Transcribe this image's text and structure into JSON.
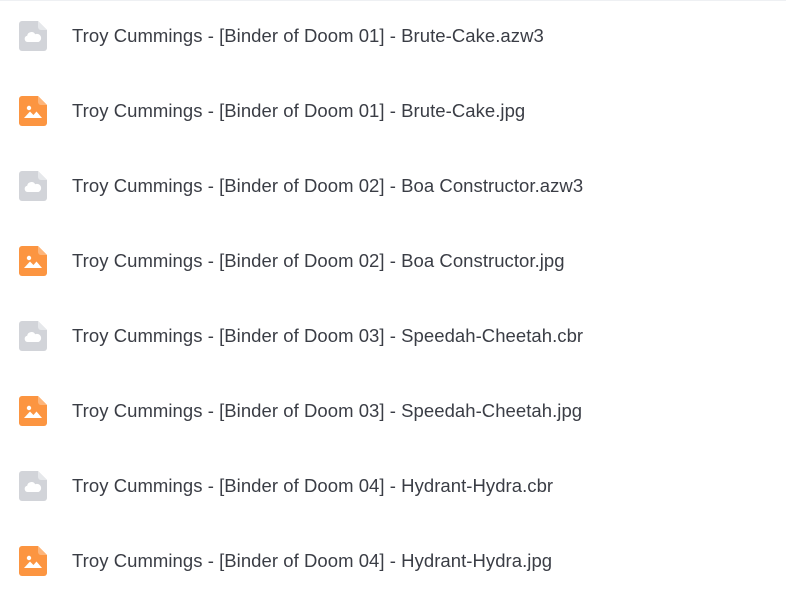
{
  "files": [
    {
      "name": "Troy Cummings - [Binder of Doom 01] - Brute-Cake.azw3",
      "icon": "cloud-file-icon",
      "color": "#d2d4d9"
    },
    {
      "name": "Troy Cummings - [Binder of Doom 01] - Brute-Cake.jpg",
      "icon": "image-file-icon",
      "color": "#fc9541"
    },
    {
      "name": "Troy Cummings - [Binder of Doom 02] - Boa Constructor.azw3",
      "icon": "cloud-file-icon",
      "color": "#d2d4d9"
    },
    {
      "name": "Troy Cummings - [Binder of Doom 02] - Boa Constructor.jpg",
      "icon": "image-file-icon",
      "color": "#fc9541"
    },
    {
      "name": "Troy Cummings - [Binder of Doom 03] - Speedah-Cheetah.cbr",
      "icon": "cloud-file-icon",
      "color": "#d2d4d9"
    },
    {
      "name": "Troy Cummings - [Binder of Doom 03] - Speedah-Cheetah.jpg",
      "icon": "image-file-icon",
      "color": "#fc9541"
    },
    {
      "name": "Troy Cummings - [Binder of Doom 04] - Hydrant-Hydra.cbr",
      "icon": "cloud-file-icon",
      "color": "#d2d4d9"
    },
    {
      "name": "Troy Cummings - [Binder of Doom 04] - Hydrant-Hydra.jpg",
      "icon": "image-file-icon",
      "color": "#fc9541"
    }
  ]
}
